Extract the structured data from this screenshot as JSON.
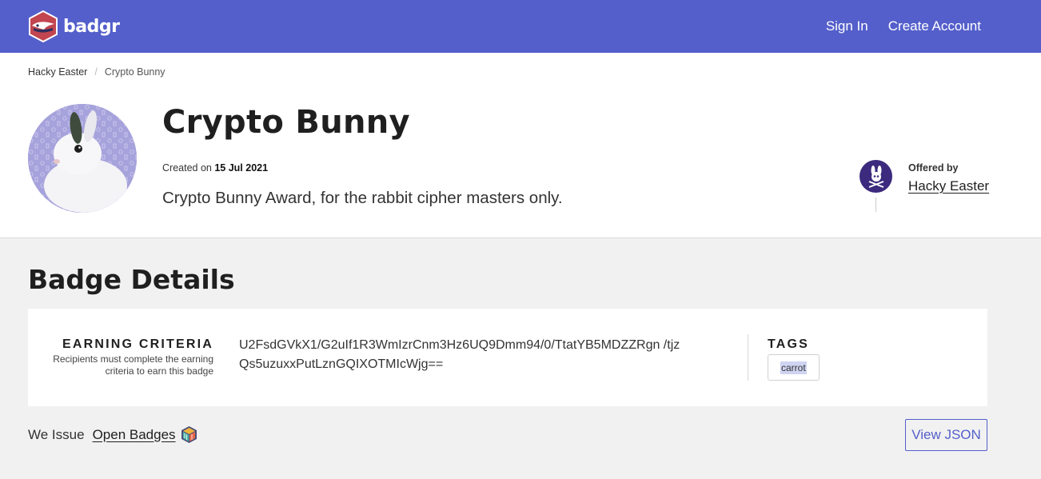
{
  "header": {
    "logo_text": "badgr",
    "nav": {
      "sign_in": "Sign In",
      "create_account": "Create Account"
    }
  },
  "breadcrumb": {
    "parent": "Hacky Easter",
    "current": "Crypto Bunny"
  },
  "badge": {
    "title": "Crypto Bunny",
    "created_label": "Created on",
    "created_date": "15 Jul 2021",
    "description": "Crypto Bunny Award, for the rabbit cipher masters only."
  },
  "issuer": {
    "offered_by_label": "Offered by",
    "name": "Hacky Easter"
  },
  "details": {
    "heading": "Badge Details",
    "criteria_title": "EARNING CRITERIA",
    "criteria_subtitle": "Recipients must complete the earning criteria to earn this badge",
    "criteria_text": "U2FsdGVkX1/G2uIf1R3WmIzrCnm3Hz6UQ9Dmm94/0/TtatYB5MDZZRgn /tjzQs5uzuxxPutLznGQIXOTMIcWjg==",
    "tags_title": "TAGS",
    "tags": [
      "carrot"
    ]
  },
  "footer": {
    "we_issue": "We Issue",
    "open_badges": "Open Badges",
    "view_json": "View JSON"
  },
  "colors": {
    "brand": "#545fcb",
    "tag_highlight": "#cfd4f2",
    "issuer_avatar": "#3b2a7d"
  }
}
